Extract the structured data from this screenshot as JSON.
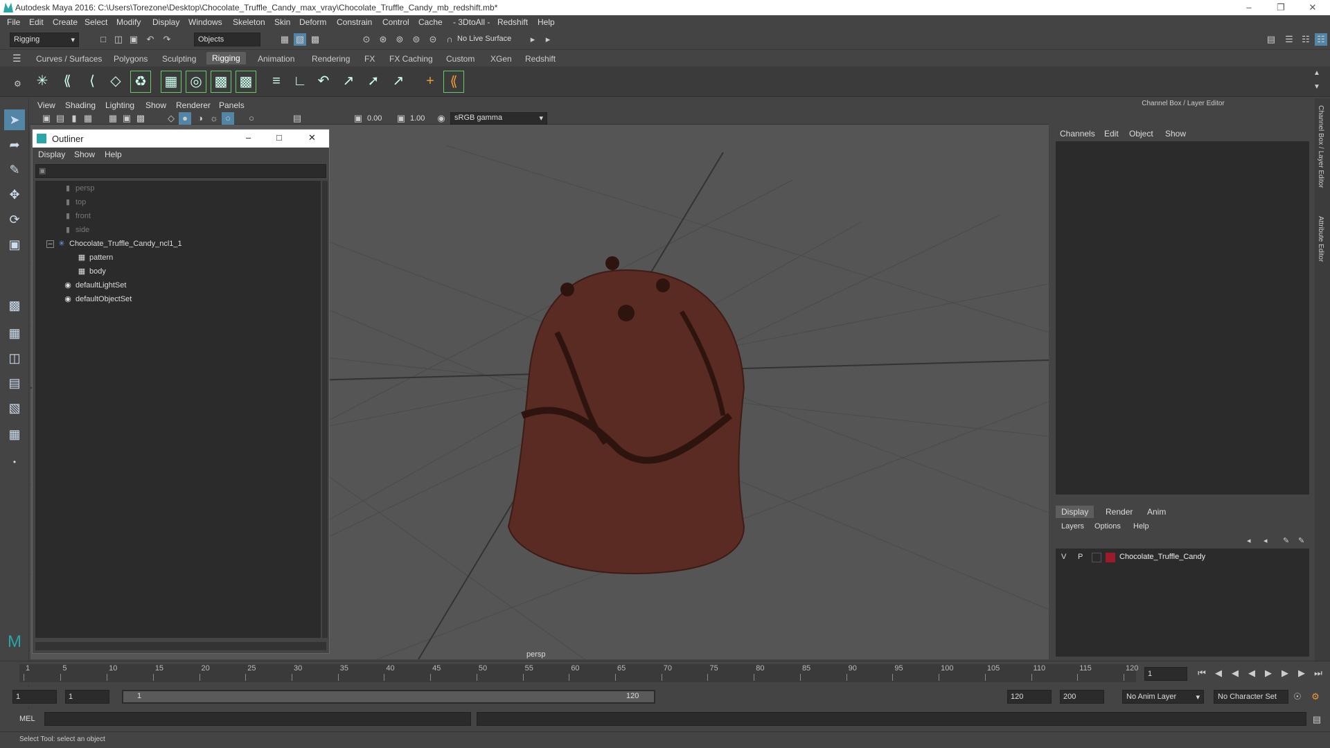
{
  "window": {
    "title": "Autodesk Maya 2016: C:\\Users\\Torezone\\Desktop\\Chocolate_Truffle_Candy_max_vray\\Chocolate_Truffle_Candy_mb_redshift.mb*"
  },
  "menubar": [
    "File",
    "Edit",
    "Create",
    "Select",
    "Modify",
    "Display",
    "Windows",
    "Skeleton",
    "Skin",
    "Deform",
    "Constrain",
    "Control",
    "Cache",
    "- 3DtoAll -",
    "Redshift",
    "Help"
  ],
  "statusline": {
    "mode": "Rigging",
    "select_mode": "Objects",
    "live_surface": "No Live Surface"
  },
  "shelf_tabs": [
    "Curves / Surfaces",
    "Polygons",
    "Sculpting",
    "Rigging",
    "Animation",
    "Rendering",
    "FX",
    "FX Caching",
    "Custom",
    "XGen",
    "Redshift"
  ],
  "shelf_active": "Rigging",
  "viewport": {
    "menu": [
      "View",
      "Shading",
      "Lighting",
      "Show",
      "Renderer",
      "Panels"
    ],
    "exposure": "0.00",
    "gamma": "1.00",
    "color_space": "sRGB gamma",
    "camera_label": "persp",
    "object_color": "#5a2b22"
  },
  "outliner": {
    "title": "Outliner",
    "menu": [
      "Display",
      "Show",
      "Help"
    ],
    "items": [
      {
        "label": "persp",
        "icon": "camera-icon"
      },
      {
        "label": "top",
        "icon": "camera-icon"
      },
      {
        "label": "front",
        "icon": "camera-icon"
      },
      {
        "label": "side",
        "icon": "camera-icon"
      },
      {
        "label": "Chocolate_Truffle_Candy_ncl1_1",
        "icon": "group-icon"
      },
      {
        "label": "pattern",
        "icon": "mesh-icon"
      },
      {
        "label": "body",
        "icon": "mesh-icon"
      },
      {
        "label": "defaultLightSet",
        "icon": "set-icon"
      },
      {
        "label": "defaultObjectSet",
        "icon": "set-icon"
      }
    ]
  },
  "channel_box": {
    "title": "Channel Box / Layer Editor",
    "menu": [
      "Channels",
      "Edit",
      "Object",
      "Show"
    ]
  },
  "layer_editor": {
    "tabs": [
      "Display",
      "Render",
      "Anim"
    ],
    "menu": [
      "Layers",
      "Options",
      "Help"
    ],
    "layer": {
      "v": "V",
      "p": "P",
      "name": "Chocolate_Truffle_Candy",
      "color": "#9b1b2a"
    }
  },
  "side_tabs": [
    "Channel Box / Layer Editor",
    "Attribute Editor"
  ],
  "timeline": {
    "ticks": [
      "1",
      "5",
      "10",
      "15",
      "20",
      "25",
      "30",
      "35",
      "40",
      "45",
      "50",
      "55",
      "60",
      "65",
      "70",
      "75",
      "80",
      "85",
      "90",
      "95",
      "100",
      "105",
      "110",
      "115",
      "120"
    ],
    "current_frame": "1"
  },
  "range": {
    "start": "1",
    "playback_start": "1",
    "slider_start": "1",
    "slider_end": "120",
    "playback_end": "120",
    "end": "200",
    "anim_layer": "No Anim Layer",
    "character_set": "No Character Set"
  },
  "command_line": {
    "label": "MEL"
  },
  "help_line": "Select Tool: select an object"
}
